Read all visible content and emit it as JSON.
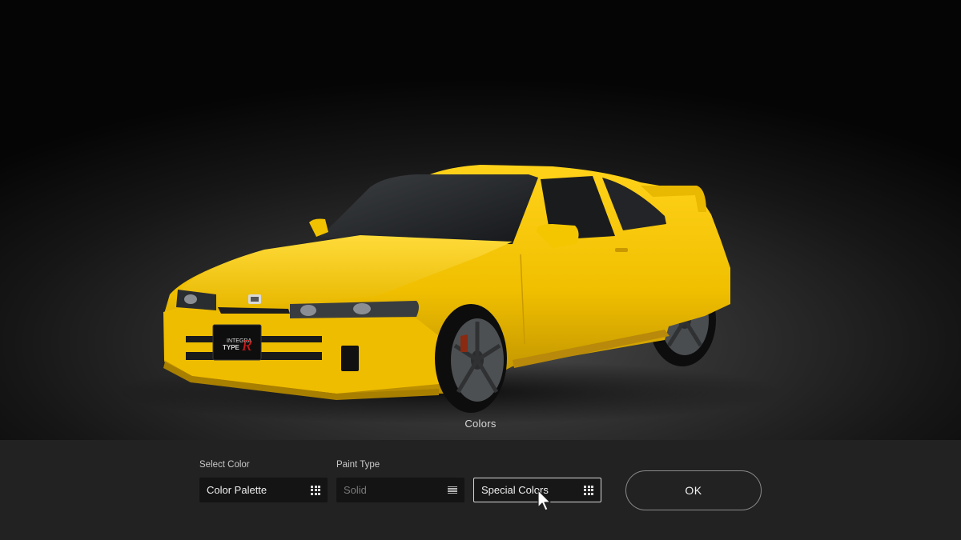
{
  "stage": {
    "caption": "Colors"
  },
  "car": {
    "badge_line1": "INTEGRA",
    "badge_line2": "TYPE",
    "badge_r": "R",
    "body_color": "#f2c500"
  },
  "panel": {
    "select_color": {
      "label": "Select Color",
      "value": "Color Palette",
      "icon": "grid-icon"
    },
    "paint_type": {
      "label": "Paint Type",
      "value": "Solid",
      "icon": "list-icon",
      "enabled": false
    },
    "special_colors": {
      "value": "Special Colors",
      "icon": "grid-icon",
      "focused": true
    },
    "ok_label": "OK"
  },
  "colors": {
    "panel_bg": "#222222",
    "field_bg": "#141414",
    "accent_border": "#d8d8d8"
  }
}
